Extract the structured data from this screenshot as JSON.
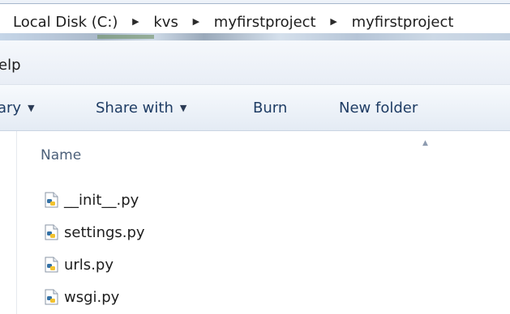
{
  "address_bar": {
    "crumbs": [
      "Local Disk (C:)",
      "kvs",
      "myfirstproject",
      "myfirstproject"
    ],
    "separator_icon": "chevron-right-icon"
  },
  "menubar": {
    "help_label": "elp"
  },
  "commandbar": {
    "library_label": "ary",
    "share_label": "Share with",
    "burn_label": "Burn",
    "new_folder_label": "New folder",
    "dropdown_icon": "chevron-down-icon"
  },
  "file_list": {
    "column_name": "Name",
    "sort_icon": "sort-up-icon",
    "file_icon": "python-file-icon",
    "files": [
      "__init__.py",
      "settings.py",
      "urls.py",
      "wsgi.py"
    ]
  },
  "colors": {
    "command_text": "#1e3c64",
    "column_header_text": "#4c607a",
    "python_blue": "#3572a5",
    "python_yellow": "#f2c230"
  }
}
